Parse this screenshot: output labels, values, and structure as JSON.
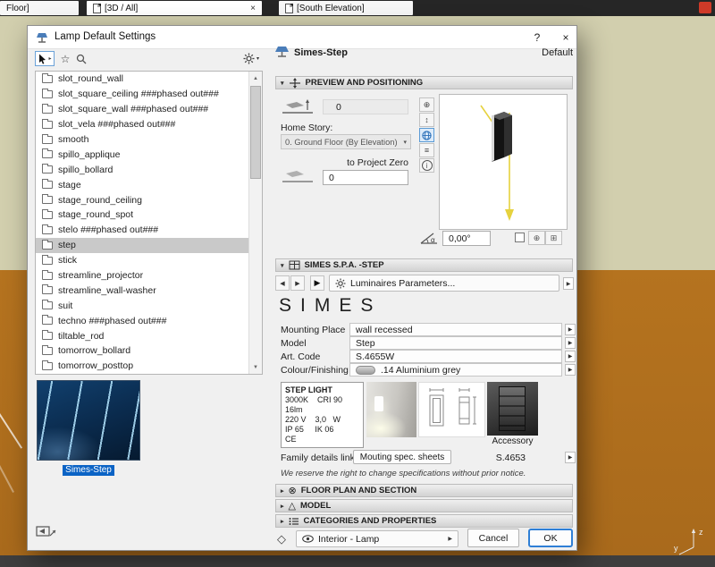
{
  "app": {
    "tabs": [
      {
        "label": "Floor]"
      },
      {
        "label": "[3D / All]"
      },
      {
        "label": "[South Elevation]"
      }
    ],
    "axis": {
      "y": "y",
      "z": "z"
    }
  },
  "glyphs": {
    "close": "×",
    "help": "?",
    "star": "☆",
    "chevron": "▾",
    "section_open": "▾",
    "section_closed": "▸",
    "left": "◀",
    "right": "▶",
    "up": "▲",
    "down": "▼",
    "plus_target": "⊕",
    "updown": "↕",
    "levels": "≡",
    "info": "i",
    "grid_plus": "⊞",
    "alpha": "α",
    "diamond": "◇",
    "circle_x": "⊗",
    "triangle": "△",
    "flyout": "▸"
  },
  "dialog": {
    "title": "Lamp Default Settings",
    "header": {
      "name": "Simes-Step",
      "state": "Default"
    },
    "tree": {
      "items": [
        "slot_round_wall",
        "slot_square_ceiling ###phased out###",
        "slot_square_wall ###phased out###",
        "slot_vela ###phased out###",
        "smooth",
        "spillo_applique",
        "spillo_bollard",
        "stage",
        "stage_round_ceiling",
        "stage_round_spot",
        "stelo ###phased out###",
        "step",
        "stick",
        "streamline_projector",
        "streamline_wall-washer",
        "suit",
        "techno ###phased out###",
        "tiltable_rod",
        "tomorrow_bollard",
        "tomorrow_posttop"
      ],
      "selected": "step"
    },
    "thumb_label": "Simes-Step",
    "preview": {
      "title": "PREVIEW AND POSITIONING",
      "height_value": "0",
      "home_story_label": "Home Story:",
      "home_story_value": "0. Ground Floor (By Elevation)",
      "to_project_zero_label": "to Project Zero",
      "to_project_zero_value": "0",
      "angle_value": "0,00°"
    },
    "simes": {
      "title": "SIMES S.P.A. -STEP",
      "params": "Luminaires Parameters...",
      "brand": "SIMES",
      "fields": [
        {
          "label": "Mounting Place",
          "value": "wall recessed"
        },
        {
          "label": "Model",
          "value": "Step"
        },
        {
          "label": "Art. Code",
          "value": "S.4655W"
        },
        {
          "label": "Colour/Finishing",
          "value": ".14 Aluminium grey"
        }
      ],
      "spec": [
        "STEP LIGHT",
        "3000K    CRI 90",
        "16lm",
        "220 V    3,0   W",
        "IP 65     IK 06",
        "CE"
      ],
      "accessory": "Accessory",
      "family_label": "Family details link",
      "family_button": "Mouting spec. sheets",
      "family_code": "S.4653",
      "disclaimer": "We reserve the right to change specifications without prior notice."
    },
    "floor_plan_title": "FLOOR PLAN AND SECTION",
    "model_title": "MODEL",
    "categories_title": "CATEGORIES AND PROPERTIES",
    "footer": {
      "layer": "Interior - Lamp",
      "cancel": "Cancel",
      "ok": "OK"
    }
  }
}
